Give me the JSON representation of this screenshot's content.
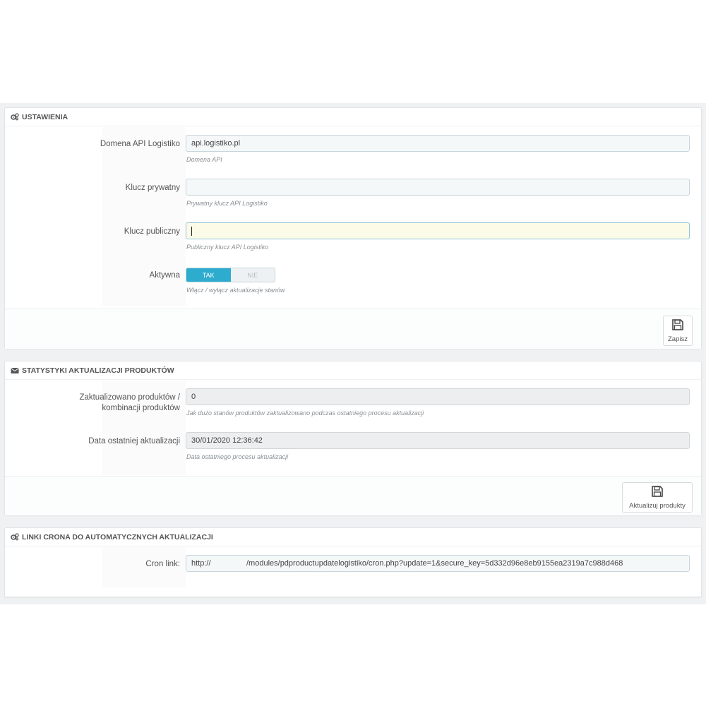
{
  "settings": {
    "title": "USTAWIENIA",
    "domain": {
      "label": "Domena API Logistiko",
      "value": "api.logistiko.pl",
      "help": "Domena API"
    },
    "private_key": {
      "label": "Klucz prywatny",
      "value": "",
      "help": "Prywatny klucz API Logistiko"
    },
    "public_key": {
      "label": "Klucz publiczny",
      "value": "",
      "help": "Publiczny klucz API Logistiko"
    },
    "active": {
      "label": "Aktywna",
      "on_label": "TAK",
      "off_label": "NIE",
      "selected": "TAK",
      "help": "Włącz / wyłącz aktualizacje stanów"
    },
    "save_label": "Zapisz"
  },
  "stats": {
    "title": "STATYSTYKI AKTUALIZACJI PRODUKTÓW",
    "updated": {
      "label": "Zaktualizowano produktów / kombinacji produktów",
      "value": "0",
      "help": "Jak dużo stanów produktów zaktualizowano podczas ostatniego procesu aktualizacji"
    },
    "last_update": {
      "label": "Data ostatniej aktualizacji",
      "value": "30/01/2020 12:36:42",
      "help": "Data ostatniego procesu aktualizacji"
    },
    "update_label": "Aktualizuj produkty"
  },
  "cron": {
    "title": "LINKI CRONA DO AUTOMATYCZNYCH AKTUALIZACJI",
    "link": {
      "label": "Cron link:",
      "prefix": "http://",
      "path": "/modules/pdproductupdatelogistiko/cron.php?update=1&secure_key=5d332d96e8eb9155ea2319a7c988d468"
    }
  },
  "icons": [
    "gears-icon",
    "envelope-icon",
    "floppy-disk-icon"
  ],
  "colors": {
    "accent": "#2eacce",
    "focus_bg": "#fbfbe8",
    "backdrop": "#eff1f2"
  }
}
